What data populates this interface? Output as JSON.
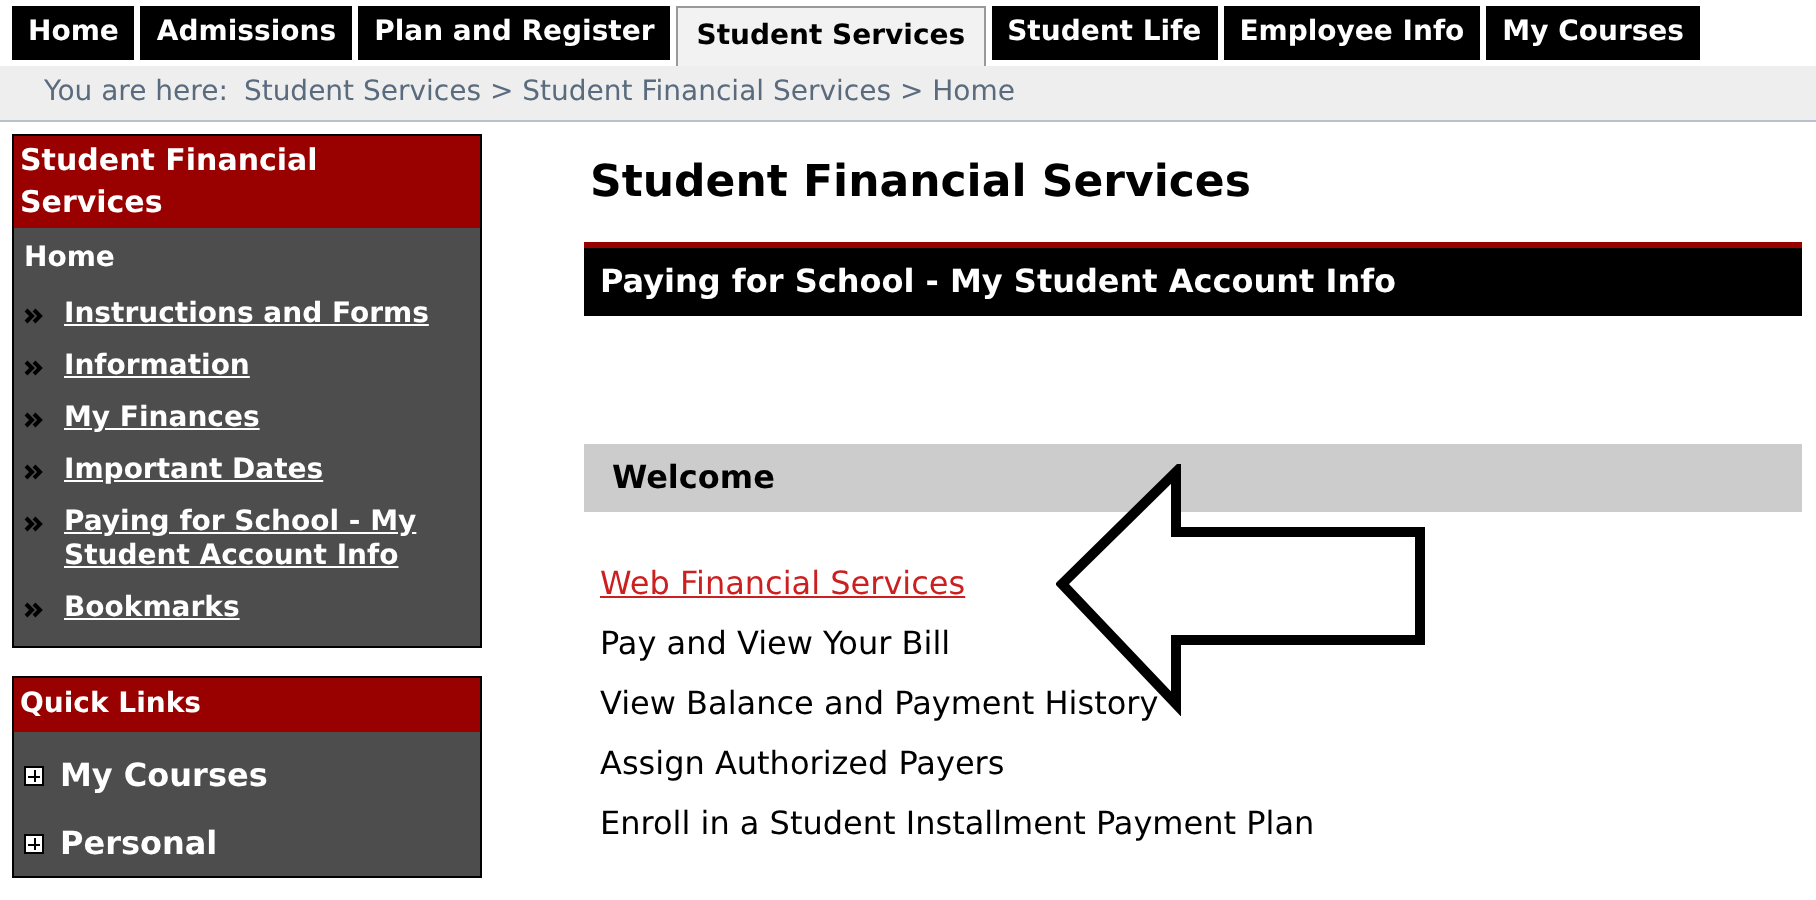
{
  "tabs": [
    {
      "label": "Home",
      "selected": false
    },
    {
      "label": "Admissions",
      "selected": false
    },
    {
      "label": "Plan and Register",
      "selected": false
    },
    {
      "label": "Student Services",
      "selected": true
    },
    {
      "label": "Student Life",
      "selected": false
    },
    {
      "label": "Employee Info",
      "selected": false
    },
    {
      "label": "My Courses",
      "selected": false
    }
  ],
  "breadcrumb": {
    "prefix": "You are here:",
    "path": "Student Services > Student Financial Services > Home"
  },
  "sidebar": {
    "title": "Student Financial Services",
    "current": "Home",
    "items": [
      "Instructions and Forms",
      "Information",
      "My Finances",
      "Important Dates",
      "Paying for School - My Student Account Info",
      "Bookmarks"
    ]
  },
  "quick_links": {
    "title": "Quick Links",
    "items": [
      "My Courses",
      "Personal"
    ]
  },
  "main": {
    "title": "Student Financial Services",
    "banner": "Paying for School - My Student Account Info",
    "section": "Welcome",
    "items": [
      {
        "label": "Web Financial Services",
        "kind": "link"
      },
      {
        "label": "Pay and View Your Bill",
        "kind": "text"
      },
      {
        "label": "View Balance and Payment History",
        "kind": "text"
      },
      {
        "label": "Assign Authorized Payers",
        "kind": "text"
      },
      {
        "label": "Enroll in a Student Installment Payment Plan",
        "kind": "text"
      }
    ]
  }
}
